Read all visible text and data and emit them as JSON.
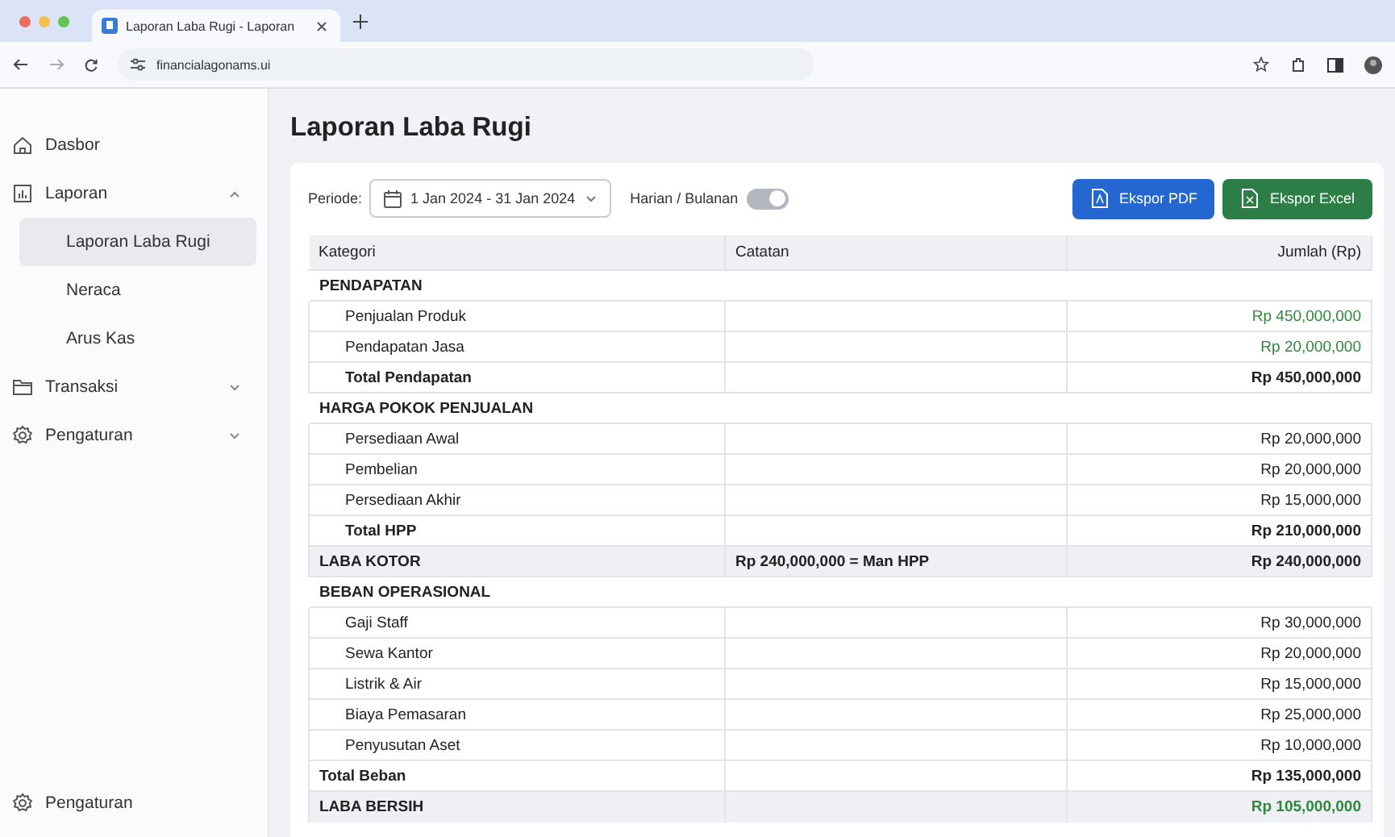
{
  "browser": {
    "tab_title": "Laporan Laba Rugi - Laporan",
    "url": "financialagonams.ui"
  },
  "sidebar": {
    "items": [
      {
        "label": "Dasbor",
        "kind": "home"
      },
      {
        "label": "Laporan",
        "kind": "chart",
        "expanded": true,
        "children": [
          {
            "label": "Laporan Laba Rugi",
            "selected": true
          },
          {
            "label": "Neraca",
            "selected": false
          },
          {
            "label": "Arus Kas",
            "selected": false
          }
        ]
      },
      {
        "label": "Transaksi",
        "kind": "folder",
        "expanded": false
      },
      {
        "label": "Pengaturan",
        "kind": "gear",
        "expanded": false
      }
    ],
    "footer": {
      "label": "Pengaturan",
      "kind": "gear"
    }
  },
  "page_title": "Laporan Laba Rugi",
  "toolbar": {
    "period_label": "Periode:",
    "period_value": "1 Jan 2024 - 31 Jan 2024",
    "toggle_label": "Harian / Bulanan",
    "toggle_on": true,
    "buttons": [
      {
        "label": "Ekspor PDF",
        "kind": "pdf"
      },
      {
        "label": "Ekspor Excel",
        "kind": "excel"
      }
    ]
  },
  "table": {
    "columns": [
      "Kategori",
      "Catatan",
      "Jumlah (Rp)"
    ],
    "rows": [
      {
        "kind": "section",
        "label": "PENDAPATAN"
      },
      {
        "kind": "item",
        "label": "Penjualan Produk",
        "amount": "Rp 450,000,000",
        "positive": true
      },
      {
        "kind": "item",
        "label": "Pendapatan Jasa",
        "amount": "Rp 20,000,000",
        "positive": true
      },
      {
        "kind": "total",
        "label": "Total Pendapatan",
        "amount": "Rp 450,000,000",
        "indented": true
      },
      {
        "kind": "section",
        "label": "HARGA POKOK PENJUALAN"
      },
      {
        "kind": "item",
        "label": "Persediaan Awal",
        "amount": "Rp 20,000,000",
        "positive": false
      },
      {
        "kind": "item",
        "label": "Pembelian",
        "amount": "Rp 20,000,000",
        "positive": false
      },
      {
        "kind": "item",
        "label": "Persediaan Akhir",
        "amount": "Rp 15,000,000",
        "positive": false
      },
      {
        "kind": "total",
        "label": "Total HPP",
        "amount": "Rp 210,000,000",
        "indented": true
      },
      {
        "kind": "highlight",
        "label": "LABA KOTOR",
        "note": "Rp 240,000,000 = Man HPP",
        "amount": "Rp 240,000,000",
        "positive": false
      },
      {
        "kind": "section",
        "label": "BEBAN OPERASIONAL"
      },
      {
        "kind": "item",
        "label": "Gaji Staff",
        "amount": "Rp 30,000,000",
        "positive": false
      },
      {
        "kind": "item",
        "label": "Sewa Kantor",
        "amount": "Rp 20,000,000",
        "positive": false
      },
      {
        "kind": "item",
        "label": "Listrik & Air",
        "amount": "Rp 15,000,000",
        "positive": false
      },
      {
        "kind": "item",
        "label": "Biaya Pemasaran",
        "amount": "Rp 25,000,000",
        "positive": false
      },
      {
        "kind": "item",
        "label": "Penyusutan Aset",
        "amount": "Rp 10,000,000",
        "positive": false
      },
      {
        "kind": "total",
        "label": "Total Beban",
        "amount": "Rp 135,000,000",
        "indented": false
      },
      {
        "kind": "highlight",
        "label": "LABA BERSIH",
        "amount": "Rp 105,000,000",
        "positive": true
      }
    ]
  }
}
